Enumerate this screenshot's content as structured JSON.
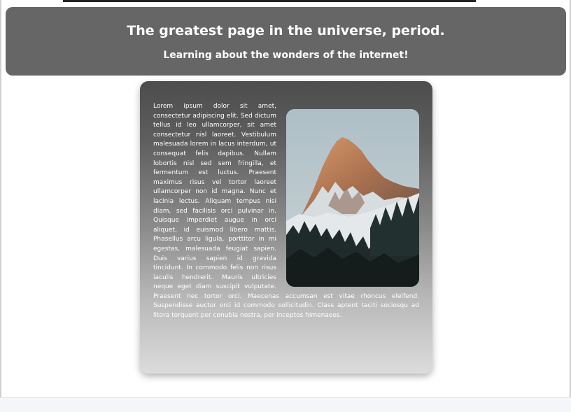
{
  "header": {
    "title": "The greatest page in the universe, period.",
    "subtitle": "Learning about the wonders of the internet!"
  },
  "content": {
    "paragraph": "Lorem ipsum dolor sit amet, consectetur adipiscing elit. Sed dictum tellus id leo ullamcorper, sit amet consectetur nisl laoreet. Vestibulum malesuada lorem in lacus interdum, ut consequat felis dapibus. Nullam lobortis nisl sed sem fringilla, et fermentum est luctus. Praesent maximus risus vel tortor laoreet ullamcorper non id magna. Nunc et lacinia lectus. Aliquam tempus nisi diam, sed facilisis orci pulvinar in. Quisque imperdiet augue in orci aliquet, id euismod libero mattis. Phasellus arcu ligula, porttitor in mi egestas, malesuada feugiat sapien. Duis varius sapien id gravida tincidunt. In commodo felis non risus iaculis hendrerit. Mauris ultricies neque eget diam suscipit vulputate. Praesent nec tortor orci. Maecenas accumsan est vitae rhoncus eleifend. Suspendisse auctor orci id commodo sollicitudin. Class aptent taciti sociosqu ad litora torquent per conubia nostra, per inceptos himenaeos.",
    "image": "mountain-photo"
  },
  "colors": {
    "header_bg": "#666666",
    "card_top": "#4d4d4d",
    "card_bottom": "#dcdcdc",
    "text": "#ffffff"
  }
}
